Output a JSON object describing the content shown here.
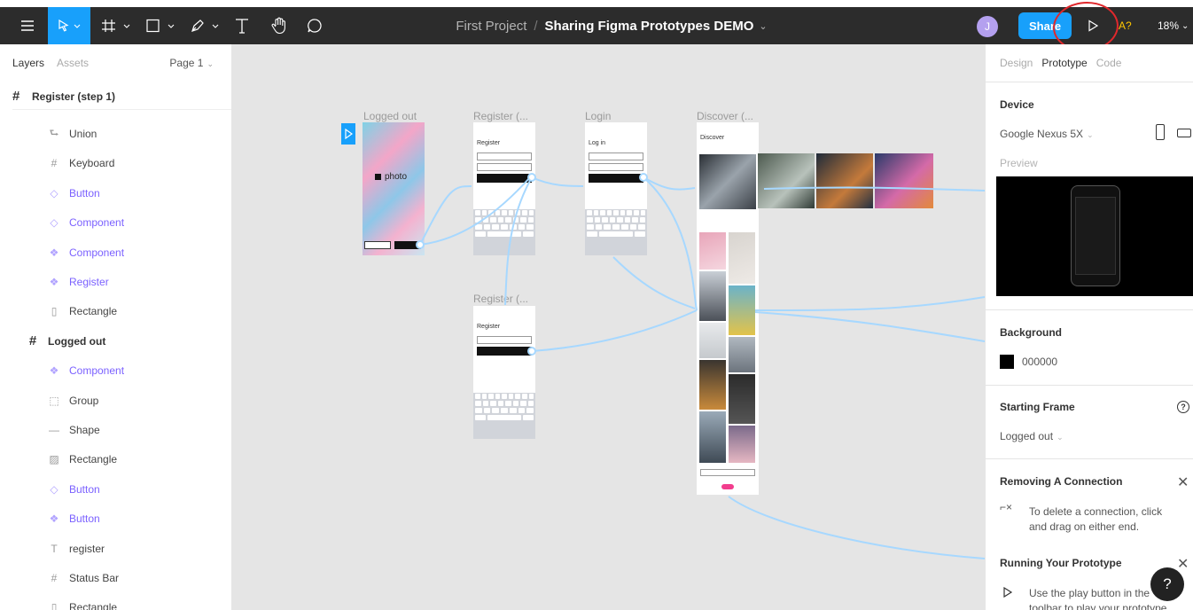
{
  "toolbar": {
    "project": "First Project",
    "separator": "/",
    "file_name": "Sharing Figma Prototypes DEMO",
    "user_initial": "J",
    "share_label": "Share",
    "a_badge": "A?",
    "zoom": "18%",
    "annotation_color": "#e0282c"
  },
  "left_panel": {
    "tab_layers": "Layers",
    "tab_assets": "Assets",
    "page": "Page 1",
    "frame_title": "Register (step 1)",
    "layers": [
      {
        "label": "Union",
        "icon": "union-icon",
        "style": "norm"
      },
      {
        "label": "Keyboard",
        "icon": "frame-icon",
        "style": "norm"
      },
      {
        "label": "Button",
        "icon": "instance-icon",
        "style": "purple"
      },
      {
        "label": "Component",
        "icon": "instance-icon",
        "style": "purple"
      },
      {
        "label": "Component",
        "icon": "component-icon",
        "style": "purple"
      },
      {
        "label": "Register",
        "icon": "component-icon",
        "style": "purple"
      },
      {
        "label": "Rectangle",
        "icon": "rectangle-icon",
        "style": "norm"
      },
      {
        "label": "Logged out",
        "icon": "frame-icon",
        "style": "frame"
      },
      {
        "label": "Component",
        "icon": "component-icon",
        "style": "purple"
      },
      {
        "label": "Group",
        "icon": "group-icon",
        "style": "norm"
      },
      {
        "label": "Shape",
        "icon": "line-icon",
        "style": "norm"
      },
      {
        "label": "Rectangle",
        "icon": "image-icon",
        "style": "norm"
      },
      {
        "label": "Button",
        "icon": "instance-icon",
        "style": "purple"
      },
      {
        "label": "Button",
        "icon": "component-icon",
        "style": "purple"
      },
      {
        "label": "register",
        "icon": "text-icon",
        "style": "norm"
      },
      {
        "label": "Status Bar",
        "icon": "frame-icon",
        "style": "norm"
      },
      {
        "label": "Rectangle",
        "icon": "rectangle-icon",
        "style": "norm"
      }
    ]
  },
  "canvas": {
    "frames": {
      "logged_out": "Logged out",
      "register_1": "Register (...",
      "login": "Login",
      "discover": "Discover (...",
      "register_2": "Register (..."
    },
    "screen_text": {
      "register_heading": "Register",
      "login_heading": "Log in",
      "discover_heading": "Discover",
      "register2_heading": "Register",
      "photo_logo": "photo"
    }
  },
  "right_panel": {
    "tab_design": "Design",
    "tab_prototype": "Prototype",
    "tab_code": "Code",
    "device_title": "Device",
    "device_value": "Google Nexus 5X",
    "preview_label": "Preview",
    "background_title": "Background",
    "background_value": "000000",
    "background_color": "#000000",
    "starting_frame_title": "Starting Frame",
    "starting_frame_value": "Logged out",
    "removing_title": "Removing A Connection",
    "removing_text": "To delete a connection, click and drag on either end.",
    "running_title": "Running Your Prototype",
    "running_text": "Use the play button in the toolbar to play your prototype",
    "help_label": "?"
  },
  "colors": {
    "accent": "#18a0fb",
    "toolbar_bg": "#2c2c2c",
    "component_purple": "#7b61ff",
    "canvas_bg": "#e5e5e5",
    "connection": "#a7d8ff"
  }
}
